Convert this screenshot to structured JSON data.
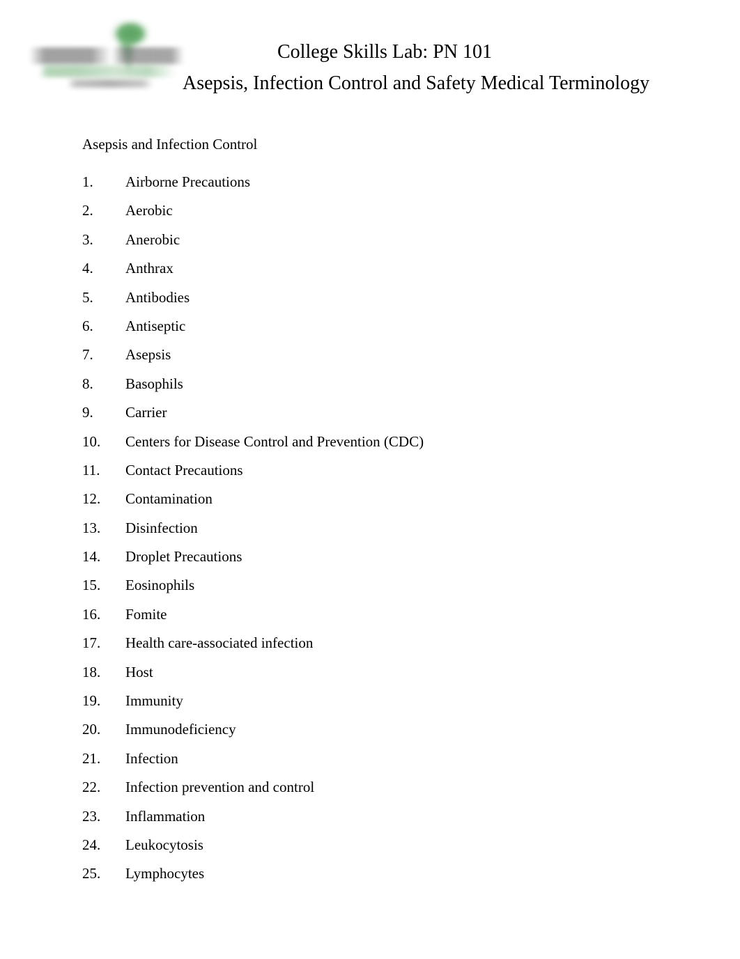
{
  "header": {
    "logo_alt": "Cincinnati State logo",
    "title_line1": "College Skills Lab: PN 101",
    "title_line2": "Asepsis, Infection Control and Safety Medical Terminology"
  },
  "body": {
    "section_heading": "Asepsis and Infection Control",
    "terms": [
      {
        "number": "1.",
        "label": "Airborne Precautions"
      },
      {
        "number": "2.",
        "label": "Aerobic"
      },
      {
        "number": "3.",
        "label": "Anerobic"
      },
      {
        "number": "4.",
        "label": "Anthrax"
      },
      {
        "number": "5.",
        "label": "Antibodies"
      },
      {
        "number": "6.",
        "label": "Antiseptic"
      },
      {
        "number": "7.",
        "label": "Asepsis"
      },
      {
        "number": "8.",
        "label": "Basophils"
      },
      {
        "number": "9.",
        "label": "Carrier"
      },
      {
        "number": "10.",
        "label": "Centers for Disease Control and Prevention (CDC)"
      },
      {
        "number": "11.",
        "label": "Contact Precautions"
      },
      {
        "number": "12.",
        "label": "Contamination"
      },
      {
        "number": "13.",
        "label": "Disinfection"
      },
      {
        "number": "14.",
        "label": "Droplet Precautions"
      },
      {
        "number": "15.",
        "label": "Eosinophils"
      },
      {
        "number": "16.",
        "label": "Fomite"
      },
      {
        "number": "17.",
        "label": "Health care-associated infection"
      },
      {
        "number": "18.",
        "label": "Host"
      },
      {
        "number": "19.",
        "label": "Immunity"
      },
      {
        "number": "20.",
        "label": "Immunodeficiency"
      },
      {
        "number": "21.",
        "label": "Infection"
      },
      {
        "number": "22.",
        "label": "Infection prevention and control"
      },
      {
        "number": "23.",
        "label": "Inflammation"
      },
      {
        "number": "24.",
        "label": "Leukocytosis"
      },
      {
        "number": "25.",
        "label": "Lymphocytes"
      }
    ]
  },
  "colors": {
    "page_background": "#ffffff",
    "text": "#000000",
    "logo_green": "#5ba362",
    "logo_gray": "#767676"
  }
}
